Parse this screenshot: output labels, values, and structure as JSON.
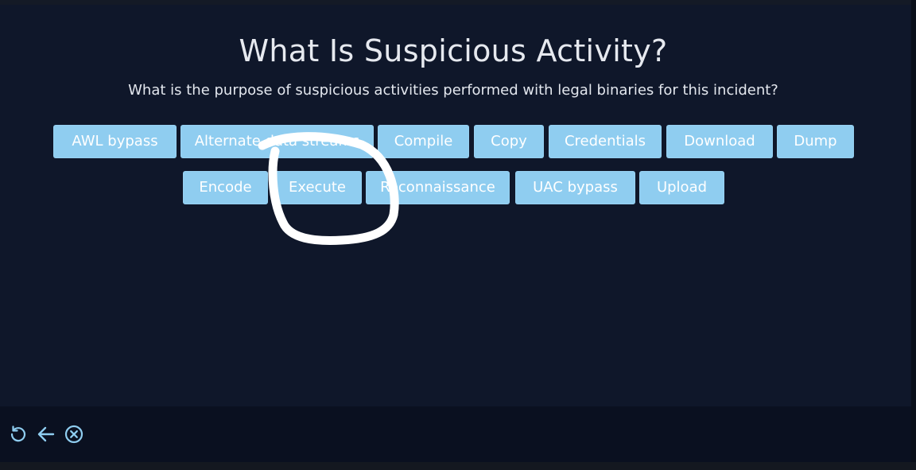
{
  "quiz": {
    "title": "What Is Suspicious Activity?",
    "question": "What is the purpose of suspicious activities performed with legal binaries for this incident?",
    "options": [
      "AWL bypass",
      "Alternate data streams",
      "Compile",
      "Copy",
      "Credentials",
      "Download",
      "Dump",
      "Encode",
      "Execute",
      "Reconnaissance",
      "UAC bypass",
      "Upload"
    ]
  },
  "controls": {
    "icons": [
      "reset-icon",
      "back-arrow-icon",
      "close-circle-icon"
    ]
  },
  "annotation": {
    "circled_option": "Execute"
  },
  "colors": {
    "background": "#0f172a",
    "button": "#8fcdf0",
    "button_text": "#ffffff",
    "control_icon": "#8fcdf0",
    "annotation": "#ffffff"
  }
}
